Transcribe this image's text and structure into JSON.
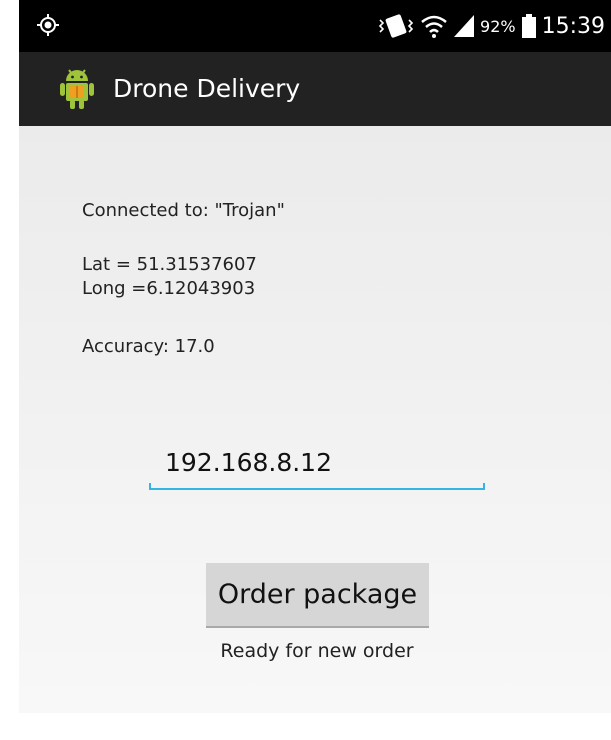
{
  "status_bar": {
    "icons": [
      "gps-icon",
      "vibrate-icon",
      "wifi-icon",
      "signal-icon",
      "battery-icon"
    ],
    "battery_percent": "92%",
    "time": "15:39"
  },
  "action_bar": {
    "app_icon": "android-app-icon",
    "title": "Drone Delivery"
  },
  "main": {
    "connected": "Connected to: \"Trojan\"",
    "lat": "Lat = 51.31537607",
    "long": "Long =6.12043903",
    "accuracy": "Accuracy: 17.0",
    "ip_value": "192.168.8.12",
    "order_button_label": "Order package",
    "status_text": "Ready for new order"
  },
  "colors": {
    "action_bar_bg": "#222222",
    "status_bar_bg": "#000000",
    "input_accent": "#33b5e5",
    "button_bg": "#d6d6d6"
  }
}
